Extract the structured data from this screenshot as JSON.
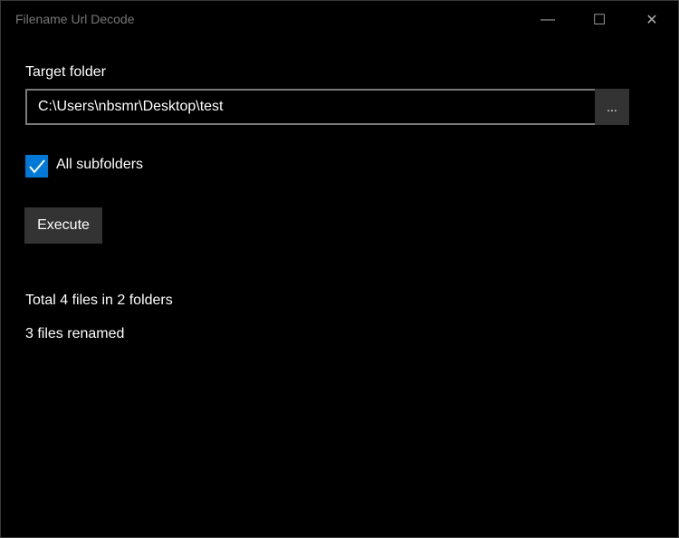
{
  "window": {
    "title": "Filename Url Decode",
    "minimize": "—",
    "maximize": "☐",
    "close": "✕"
  },
  "form": {
    "target_label": "Target folder",
    "target_value": "C:\\Users\\nbsmr\\Desktop\\test",
    "browse_label": "...",
    "subfolders_label": "All subfolders",
    "subfolders_checked": true,
    "execute_label": "Execute"
  },
  "status": {
    "total": "Total 4 files in 2 folders",
    "renamed": "3 files renamed"
  },
  "colors": {
    "accent": "#0078d7"
  }
}
